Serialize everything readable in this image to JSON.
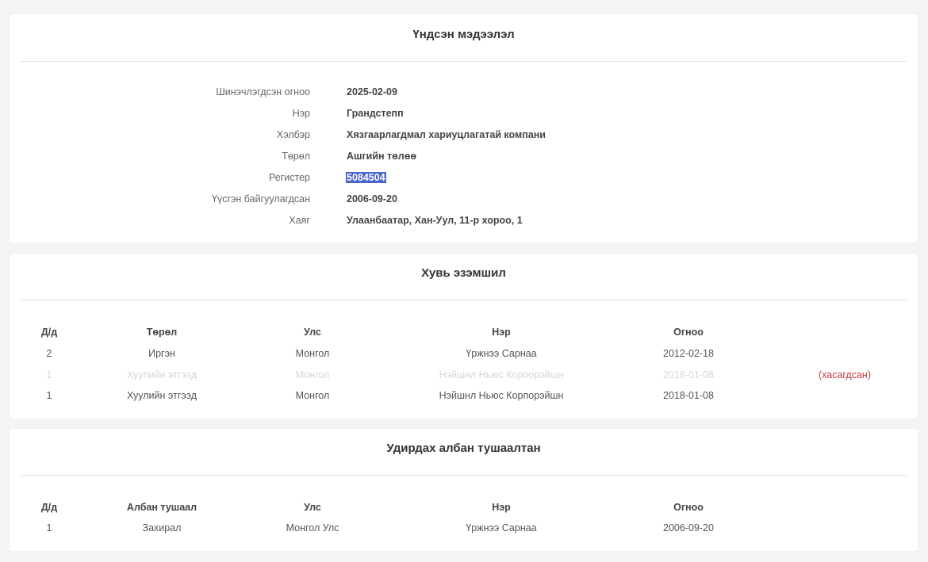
{
  "basic_info": {
    "title": "Үндсэн мэдээлэл",
    "rows": [
      {
        "label": "Шинэчлэгдсэн огноо",
        "value": "2025-02-09"
      },
      {
        "label": "Нэр",
        "value": "Грандстепп"
      },
      {
        "label": "Хэлбэр",
        "value": "Хязгаарлагдмал хариуцлагатай компани"
      },
      {
        "label": "Төрөл",
        "value": "Ашгийн төлөө"
      },
      {
        "label": "Регистер",
        "value": "5084504"
      },
      {
        "label": "Үүсгэн байгуулагдсан",
        "value": "2006-09-20"
      },
      {
        "label": "Хаяг",
        "value": "Улаанбаатар, Хан-Уул, 11-р хороо, 1"
      }
    ]
  },
  "ownership": {
    "title": "Хувь эзэмшил",
    "headers": {
      "no": "Д/д",
      "type": "Төрөл",
      "country": "Улс",
      "name": "Нэр",
      "date": "Огноо"
    },
    "rows": [
      {
        "no": "2",
        "type": "Иргэн",
        "country": "Монгол",
        "name": "Үржнээ Сарнаа",
        "date": "2012-02-18",
        "status": ""
      },
      {
        "no": "1",
        "type": "Хуулийн этгээд",
        "country": "Монгол",
        "name": "Нэйшнл Ньюс Корпорэйшн",
        "date": "2018-01-08",
        "status": "(хасагдсан)"
      },
      {
        "no": "1",
        "type": "Хуулийн этгээд",
        "country": "Монгол",
        "name": "Нэйшнл Ньюс Корпорэйшн",
        "date": "2018-01-08",
        "status": ""
      }
    ]
  },
  "officials": {
    "title": "Удирдах албан тушаалтан",
    "headers": {
      "no": "Д/д",
      "position": "Албан тушаал",
      "country": "Улс",
      "name": "Нэр",
      "date": "Огноо"
    },
    "rows": [
      {
        "no": "1",
        "position": "Захирал",
        "country": "Монгол Улс",
        "name": "Үржнээ Сарнаа",
        "date": "2006-09-20"
      }
    ]
  },
  "colors": {
    "selection": "#4a66c8",
    "removed_status": "#c43b3b",
    "faded_row": "#d6d6d6"
  }
}
